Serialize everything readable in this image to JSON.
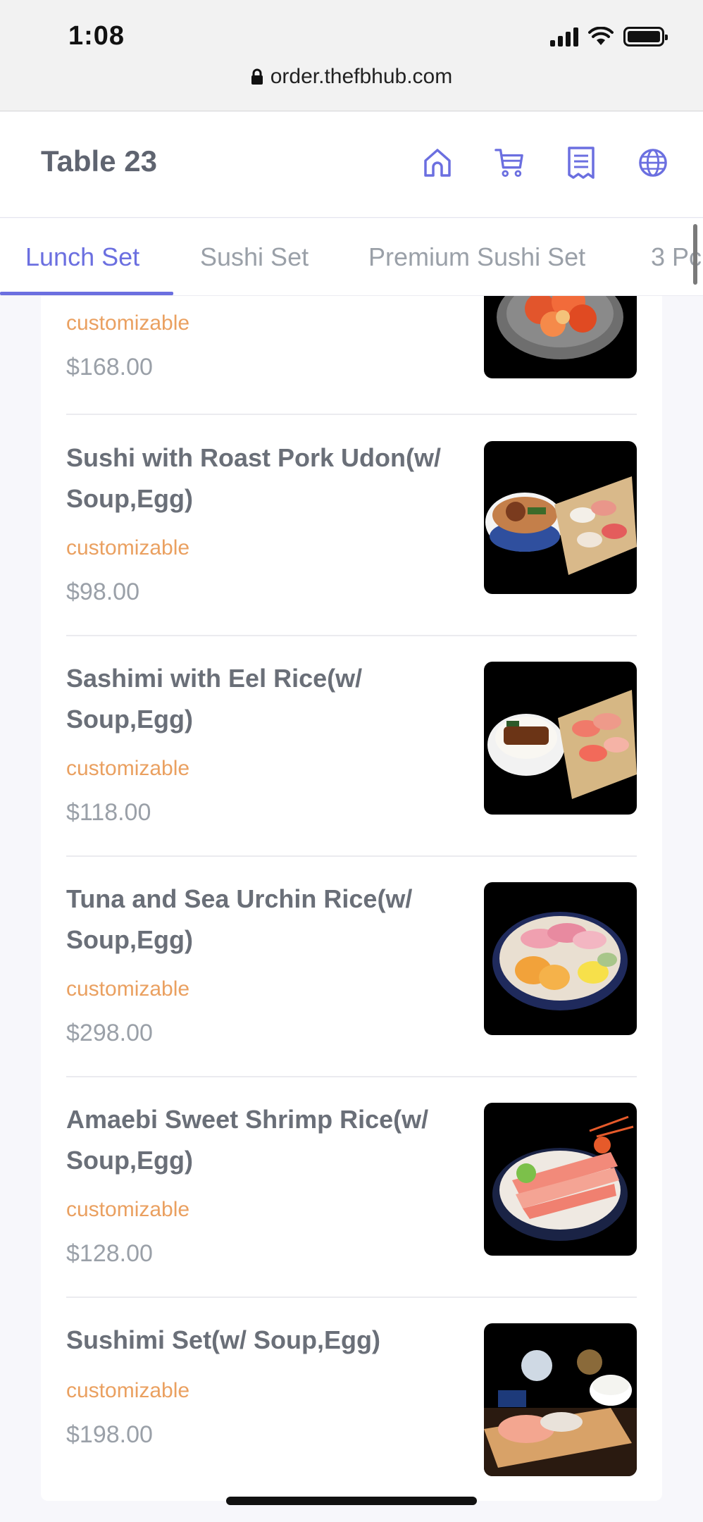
{
  "status": {
    "time": "1:08"
  },
  "browser": {
    "url": "order.thefbhub.com"
  },
  "header": {
    "title": "Table 23",
    "icons": [
      "home-icon",
      "cart-icon",
      "receipt-icon",
      "globe-icon"
    ],
    "accent_color": "#6b6fe0"
  },
  "tabs": [
    {
      "label": "Lunch Set",
      "active": true
    },
    {
      "label": "Sushi Set"
    },
    {
      "label": "Premium Sushi Set"
    },
    {
      "label": "3 Pc"
    }
  ],
  "menu": {
    "tag_color": "#eaa060",
    "items": [
      {
        "name": "",
        "tag": "customizable",
        "price": "$168.00"
      },
      {
        "name": "Sushi with Roast Pork Udon(w/ Soup,Egg)",
        "tag": "customizable",
        "price": "$98.00"
      },
      {
        "name": "Sashimi with Eel Rice(w/ Soup,Egg)",
        "tag": "customizable",
        "price": "$118.00"
      },
      {
        "name": "Tuna and Sea Urchin Rice(w/ Soup,Egg)",
        "tag": "customizable",
        "price": "$298.00"
      },
      {
        "name": "Amaebi Sweet Shrimp Rice(w/ Soup,Egg)",
        "tag": "customizable",
        "price": "$128.00"
      },
      {
        "name": "Sushimi Set(w/ Soup,Egg)",
        "tag": "customizable",
        "price": "$198.00"
      }
    ]
  }
}
